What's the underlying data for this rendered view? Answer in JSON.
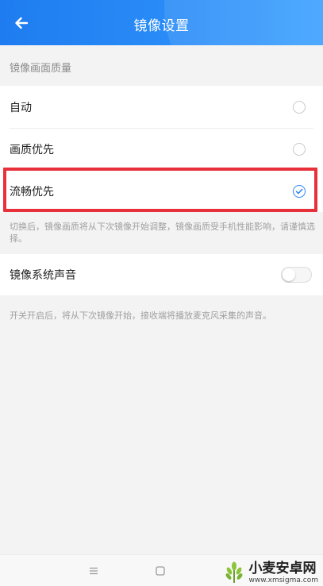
{
  "header": {
    "title": "镜像设置",
    "back_icon": "arrow-left-icon"
  },
  "quality": {
    "section_title": "镜像画面质量",
    "options": [
      {
        "label": "自动",
        "selected": false
      },
      {
        "label": "画质优先",
        "selected": false
      },
      {
        "label": "流畅优先",
        "selected": true
      }
    ],
    "hint": "切换后，镜像画质将从下次镜像开始调整，镜像画质受手机性能影响，请谨慎选择。"
  },
  "sound": {
    "label": "镜像系统声音",
    "enabled": false,
    "hint": "开关开启后，将从下次镜像开始，接收端将播放麦克风采集的声音。"
  },
  "navbar": {
    "menu_icon": "menu-icon",
    "home_icon": "home-square-icon"
  },
  "watermark": {
    "name": "小麦安卓网",
    "url": "www.xmsigma.com"
  },
  "colors": {
    "accent": "#2f86f4",
    "highlight": "#e8303a",
    "header": "#2288f5"
  }
}
